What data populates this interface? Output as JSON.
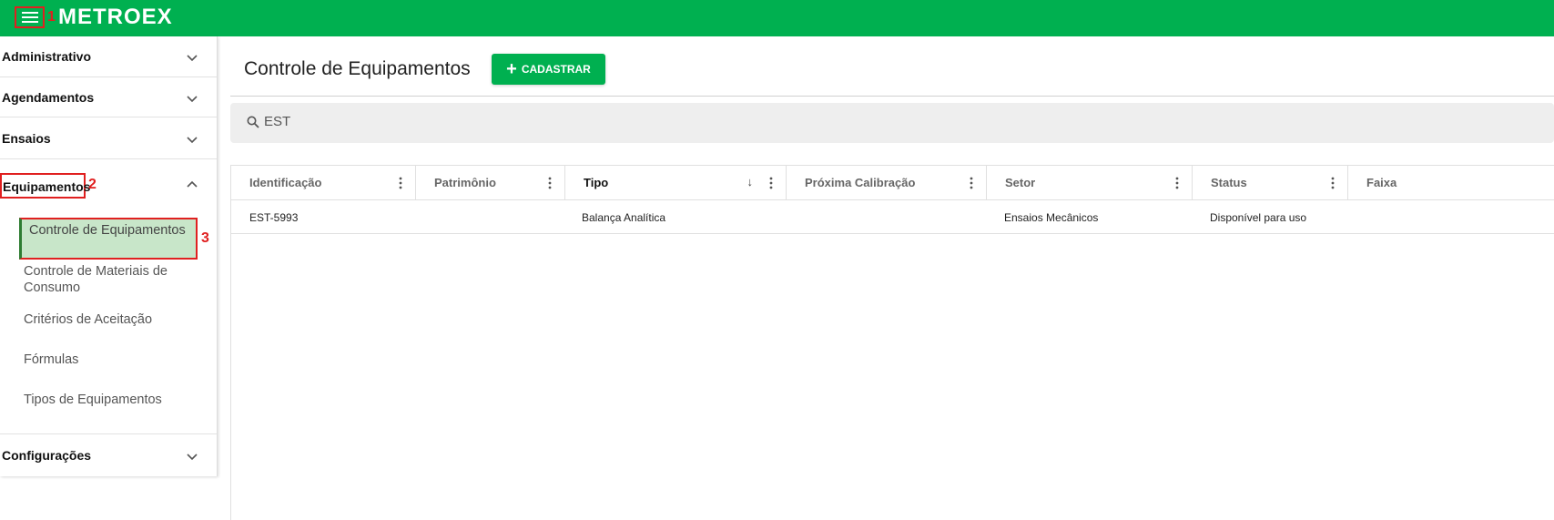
{
  "header": {
    "logo": "METROEX",
    "markers": [
      "1",
      "2",
      "3"
    ]
  },
  "colors": {
    "brand": "#00b050",
    "active_bg": "#c8e6c9",
    "highlight": "#e02020"
  },
  "sidebar": {
    "sections": [
      {
        "label": "Administrativo",
        "expanded": false
      },
      {
        "label": "Agendamentos",
        "expanded": false
      },
      {
        "label": "Ensaios",
        "expanded": false
      },
      {
        "label": "Equipamentos",
        "expanded": true
      },
      {
        "label": "Configurações",
        "expanded": false
      }
    ],
    "sub_items": [
      {
        "label": "Controle de Equipamentos",
        "active": true
      },
      {
        "label": "Controle de Materiais de Consumo"
      },
      {
        "label": "Critérios de Aceitação"
      },
      {
        "label": "Fórmulas"
      },
      {
        "label": "Tipos de Equipamentos"
      }
    ]
  },
  "main": {
    "title": "Controle de Equipamentos",
    "add_button": "CADASTRAR",
    "search": {
      "value": "EST",
      "icon": "search-icon"
    },
    "table": {
      "columns": [
        "Identificação",
        "Patrimônio",
        "Tipo",
        "Próxima Calibração",
        "Setor",
        "Status",
        "Faixa"
      ],
      "sorted_column": "Tipo",
      "rows": [
        [
          "EST-5993",
          "",
          "Balança Analítica",
          "",
          "Ensaios Mecânicos",
          "Disponível para uso",
          ""
        ]
      ]
    }
  }
}
